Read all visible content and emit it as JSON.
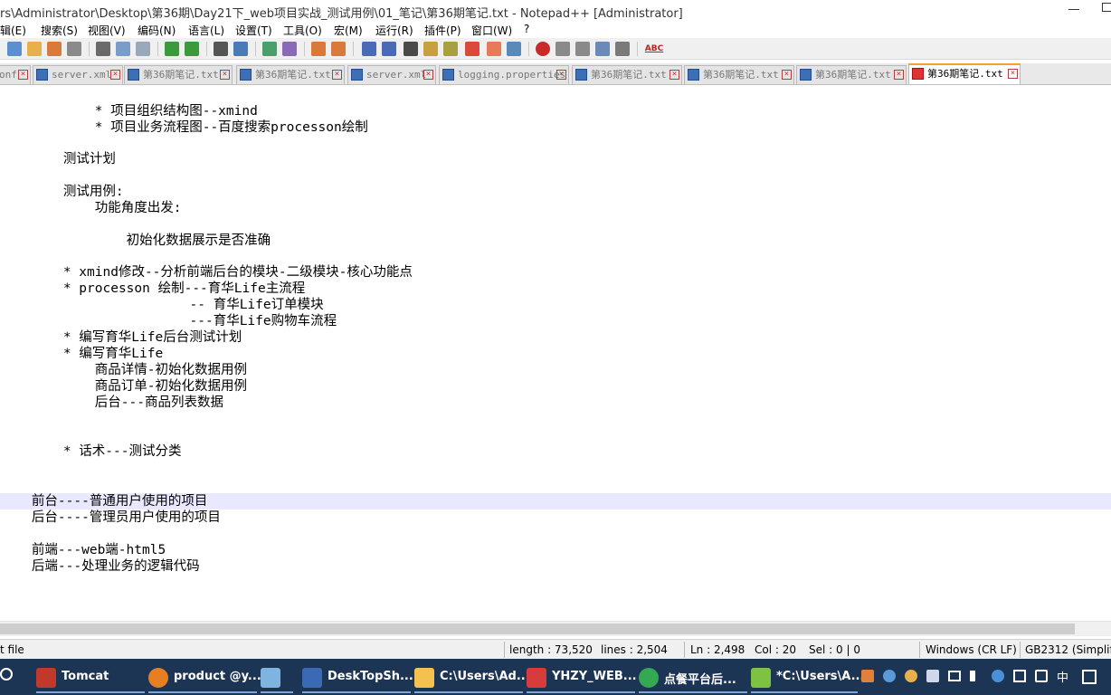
{
  "window": {
    "title": "rs\\Administrator\\Desktop\\第36期\\Day21下_web项目实战_测试用例\\01_笔记\\第36期笔记.txt - Notepad++ [Administrator]"
  },
  "menu": [
    "辑(E)",
    "搜索(S)",
    "视图(V)",
    "编码(N)",
    "语言(L)",
    "设置(T)",
    "工具(O)",
    "宏(M)",
    "运行(R)",
    "插件(P)",
    "窗口(W)",
    "?"
  ],
  "toolbar": {
    "icons": [
      "new-file-icon",
      "open-file-icon",
      "save-icon",
      "save-all-icon",
      "print-icon",
      "cut-icon",
      "copy-icon",
      "paste-icon",
      "undo-icon",
      "redo-icon",
      "find-icon",
      "replace-icon",
      "zoom-in-icon",
      "zoom-out-icon",
      "sync-v-icon",
      "sync-h-icon",
      "wrap-icon",
      "show-all-icon",
      "indent-guide-icon",
      "udl-icon",
      "doc-map-icon",
      "function-list-icon",
      "folder-icon",
      "monitor-icon",
      "record-macro-icon",
      "stop-macro-icon",
      "play-macro-icon",
      "run-macro-multiple-icon",
      "save-macro-icon",
      "spellcheck-icon"
    ],
    "spellcheck_label": "ABC"
  },
  "tabs": [
    {
      "label": "onf",
      "active": false
    },
    {
      "label": "server.xml",
      "active": false
    },
    {
      "label": "第36期笔记.txt",
      "active": false
    },
    {
      "label": "第36期笔记.txt",
      "active": false
    },
    {
      "label": "server.xml",
      "active": false
    },
    {
      "label": "logging.properties",
      "active": false
    },
    {
      "label": "第36期笔记.txt",
      "active": false
    },
    {
      "label": "第36期笔记.txt",
      "active": false
    },
    {
      "label": "第36期笔记.txt",
      "active": false
    },
    {
      "label": "第36期笔记.txt",
      "active": true
    }
  ],
  "editor": {
    "lines": [
      "            * 项目组织结构图--xmind",
      "            * 项目业务流程图--百度搜索processon绘制",
      "",
      "        测试计划",
      "",
      "        测试用例:",
      "            功能角度出发:",
      "",
      "                初始化数据展示是否准确",
      "",
      "        * xmind修改--分析前端后台的模块-二级模块-核心功能点",
      "        * processon 绘制---育华Life主流程",
      "                        -- 育华Life订单模块",
      "                        ---育华Life购物车流程",
      "        * 编写育华Life后台测试计划",
      "        * 编写育华Life",
      "            商品详情-初始化数据用例",
      "            商品订单-初始化数据用例",
      "            后台---商品列表数据",
      "",
      "",
      "        * 话术---测试分类",
      "",
      "",
      "    前台----普通用户使用的项目",
      "    后台----管理员用户使用的项目",
      "",
      "    前端---web端-html5",
      "    后端---处理业务的逻辑代码"
    ],
    "current_line_index": 24
  },
  "status": {
    "file_type": "t file",
    "length": "length : 73,520",
    "lines": "lines : 2,504",
    "ln": "Ln : 2,498",
    "col": "Col : 20",
    "sel": "Sel : 0 | 0",
    "eol": "Windows (CR LF)",
    "encoding": "GB2312 (Simplifi"
  },
  "taskbar": {
    "items": [
      {
        "label": "Tomcat",
        "icon": "tomcat-icon",
        "color": "#c0392b"
      },
      {
        "label": "product @y...",
        "icon": "product-icon",
        "color": "#e67e22"
      },
      {
        "label": "",
        "icon": "notepad-icon",
        "color": "#7fb3e0"
      },
      {
        "label": "DeskTopSh...",
        "icon": "desktop-share-icon",
        "color": "#3a6ab5"
      },
      {
        "label": "C:\\Users\\Ad...",
        "icon": "folder-icon",
        "color": "#f2c14e"
      },
      {
        "label": "YHZY_WEB...",
        "icon": "vs-icon",
        "color": "#d63c3c"
      },
      {
        "label": "点餐平台后...",
        "icon": "chrome-icon",
        "color": "#34a853"
      },
      {
        "label": "*C:\\Users\\A...",
        "icon": "notepadpp-icon",
        "color": "#7dc242"
      }
    ],
    "tray": {
      "ime": "中"
    }
  }
}
